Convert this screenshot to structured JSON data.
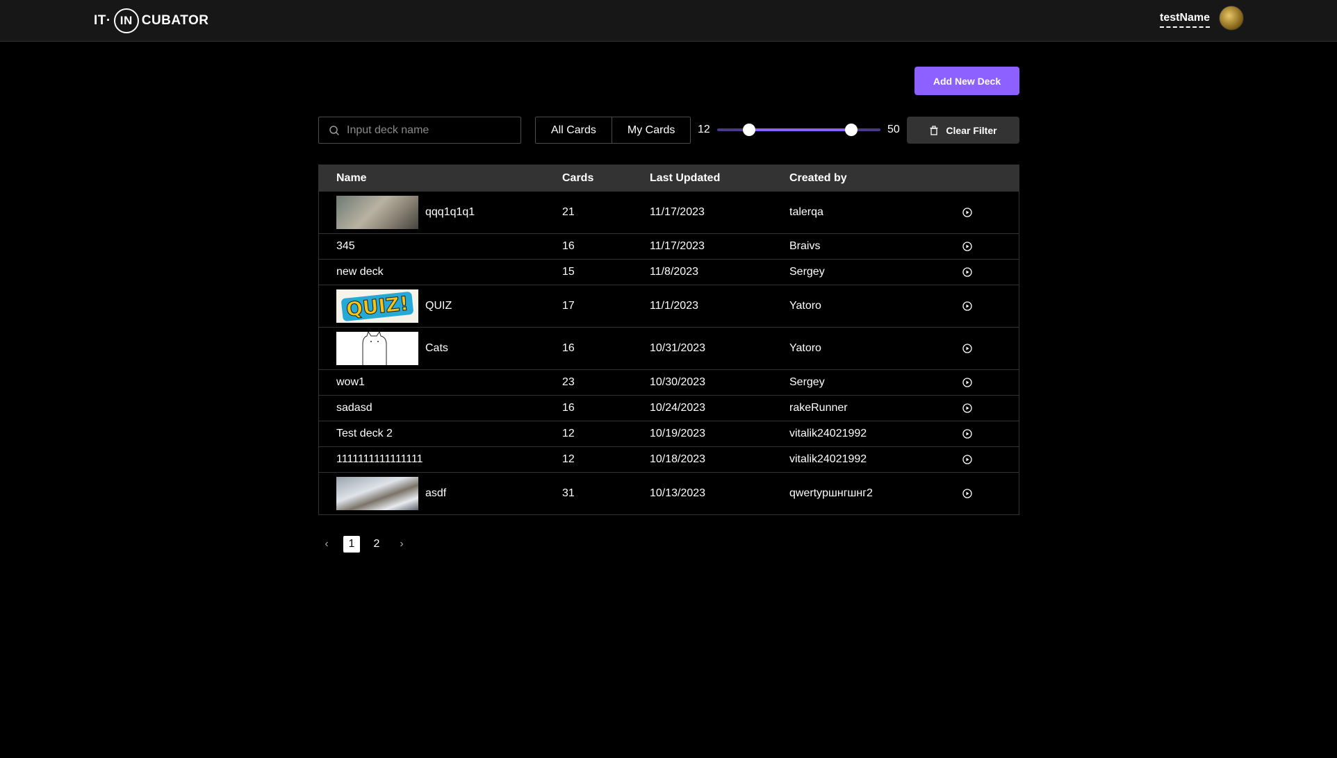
{
  "header": {
    "logo_left": "IT·",
    "logo_circle": "IN",
    "logo_right": "CUBATOR",
    "user_name": "testName"
  },
  "toolbar": {
    "add_deck_label": "Add New Deck",
    "search_placeholder": "Input deck name",
    "tabs": [
      "All Cards",
      "My Cards"
    ],
    "range_min": "12",
    "range_max": "50",
    "range_scale_max": 61,
    "clear_filter_label": "Clear Filter"
  },
  "table": {
    "headers": [
      "Name",
      "Cards",
      "Last Updated",
      "Created by"
    ],
    "rows": [
      {
        "name": "qqq1q1q1",
        "cards": "21",
        "updated": "11/17/2023",
        "created_by": "talerqa",
        "thumb": "cat-photo"
      },
      {
        "name": "345",
        "cards": "16",
        "updated": "11/17/2023",
        "created_by": "Braivs",
        "thumb": ""
      },
      {
        "name": "new deck",
        "cards": "15",
        "updated": "11/8/2023",
        "created_by": "Sergey",
        "thumb": ""
      },
      {
        "name": "QUIZ",
        "cards": "17",
        "updated": "11/1/2023",
        "created_by": "Yatoro",
        "thumb": "quiz-image"
      },
      {
        "name": "Cats",
        "cards": "16",
        "updated": "10/31/2023",
        "created_by": "Yatoro",
        "thumb": "cat-drawing"
      },
      {
        "name": "wow1",
        "cards": "23",
        "updated": "10/30/2023",
        "created_by": "Sergey",
        "thumb": ""
      },
      {
        "name": "sadasd",
        "cards": "16",
        "updated": "10/24/2023",
        "created_by": "rakeRunner",
        "thumb": ""
      },
      {
        "name": "Test deck 2",
        "cards": "12",
        "updated": "10/19/2023",
        "created_by": "vitalik24021992",
        "thumb": ""
      },
      {
        "name": "1111111111111111",
        "cards": "12",
        "updated": "10/18/2023",
        "created_by": "vitalik24021992",
        "thumb": ""
      },
      {
        "name": "asdf",
        "cards": "31",
        "updated": "10/13/2023",
        "created_by": "qwertyршнгшнг2",
        "thumb": "snow-photo"
      }
    ],
    "quiz_thumb_text": "QUIZ!"
  },
  "pagination": {
    "prev": "‹",
    "pages": [
      "1",
      "2"
    ],
    "active_page": "1",
    "next": "›"
  },
  "colors": {
    "accent": "#8c61ff",
    "header_bg": "#171717",
    "table_header_bg": "#333333"
  }
}
